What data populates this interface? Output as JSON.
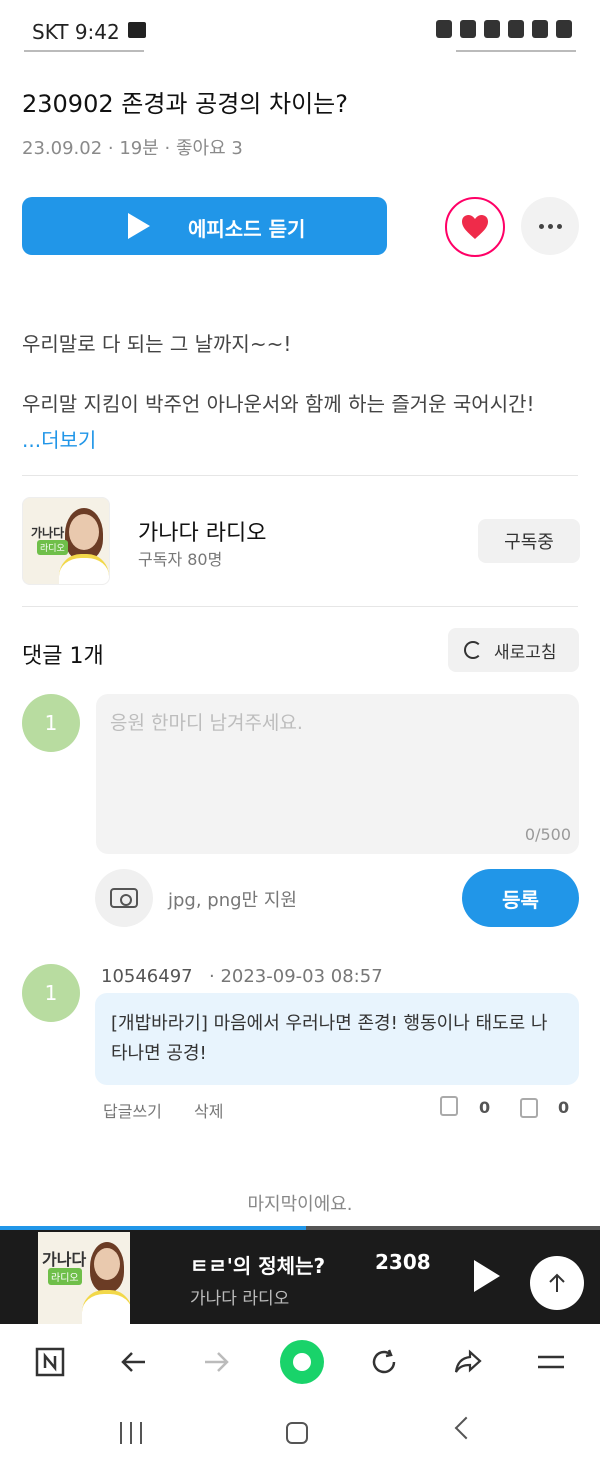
{
  "status_bar": {
    "carrier_time": "SKT 9:42"
  },
  "episode": {
    "title": "230902 존경과 공경의 차이는?",
    "meta": "23.09.02 · 19분 · 좋아요 3",
    "play_label": "에피소드 듣기",
    "description_line1": "우리말로 다 되는 그 날까지~~!",
    "description_line2": "우리말 지킴이 박주언 아나운서와 함께 하는 즐거운 국어시간!",
    "more_label": "...더보기"
  },
  "channel": {
    "thumb_title": "가나다",
    "thumb_sub": "라디오",
    "name": "가나다 라디오",
    "subscribers": "구독자 80명",
    "subscribe_label": "구독중"
  },
  "comments": {
    "title": "댓글 1개",
    "refresh_label": "새로고침",
    "my_avatar": "1",
    "input_placeholder": "응원 한마디 남겨주세요.",
    "input_value": "",
    "char_count": "0/500",
    "upload_note": "jpg, png만 지원",
    "submit_label": "등록",
    "items": [
      {
        "avatar": "1",
        "user": "10546497",
        "date": "· 2023-09-03 08:57",
        "text": "[개밥바라기] 마음에서 우러나면 존경! 행동이나 태도로 나타나면 공경!",
        "reply_label": "답글쓰기",
        "delete_label": "삭제",
        "likes": "0",
        "dislikes": "0"
      }
    ],
    "end_note": "마지막이에요."
  },
  "player": {
    "thumb_title": "가나다",
    "thumb_sub": "라디오",
    "title": "ㅌㄹ'의 정체는?",
    "code": "2308",
    "channel": "가나다 라디오",
    "progress": 0.51
  },
  "colors": {
    "accent": "#2196e8",
    "like": "#ff2266",
    "avatar": "#b8dca0",
    "bubble": "#e8f4fd",
    "player_bg": "#1b1b1b",
    "green": "#19d36a"
  },
  "icons": {
    "browser": [
      "naver-n-icon",
      "back-arrow-icon",
      "forward-arrow-icon",
      "green-circle-icon",
      "reload-icon",
      "share-icon",
      "menu-icon"
    ],
    "system": [
      "recent-apps-icon",
      "home-icon",
      "back-icon"
    ]
  }
}
